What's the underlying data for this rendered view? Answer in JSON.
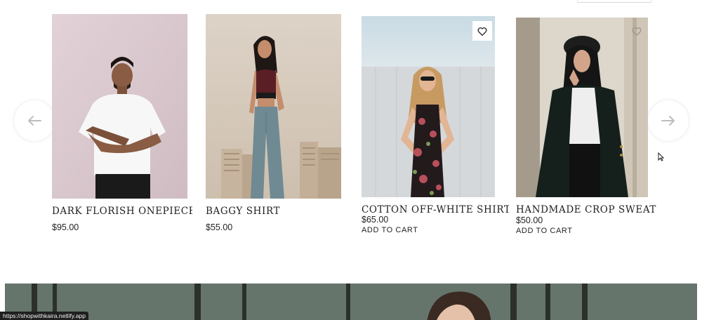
{
  "products": [
    {
      "title": "DARK FLORISH ONEPIECE",
      "price": "$95.00"
    },
    {
      "title": "BAGGY SHIRT",
      "price": "$55.00"
    },
    {
      "title": "COTTON OFF-WHITE SHIRT",
      "price": "$65.00",
      "cart": "ADD TO CART"
    },
    {
      "title": "HANDMADE CROP SWEATER",
      "price": "$50.00",
      "cart": "ADD TO CART"
    }
  ],
  "icons": {
    "prev": "arrow-left-icon",
    "next": "arrow-right-icon",
    "wishlist": "heart-icon"
  },
  "status_bar": {
    "url": "https://shopwithkaira.netlify.app"
  },
  "colors": {
    "text": "#222222",
    "arrow": "#bdbdbd",
    "banner": "#5f6b62"
  }
}
